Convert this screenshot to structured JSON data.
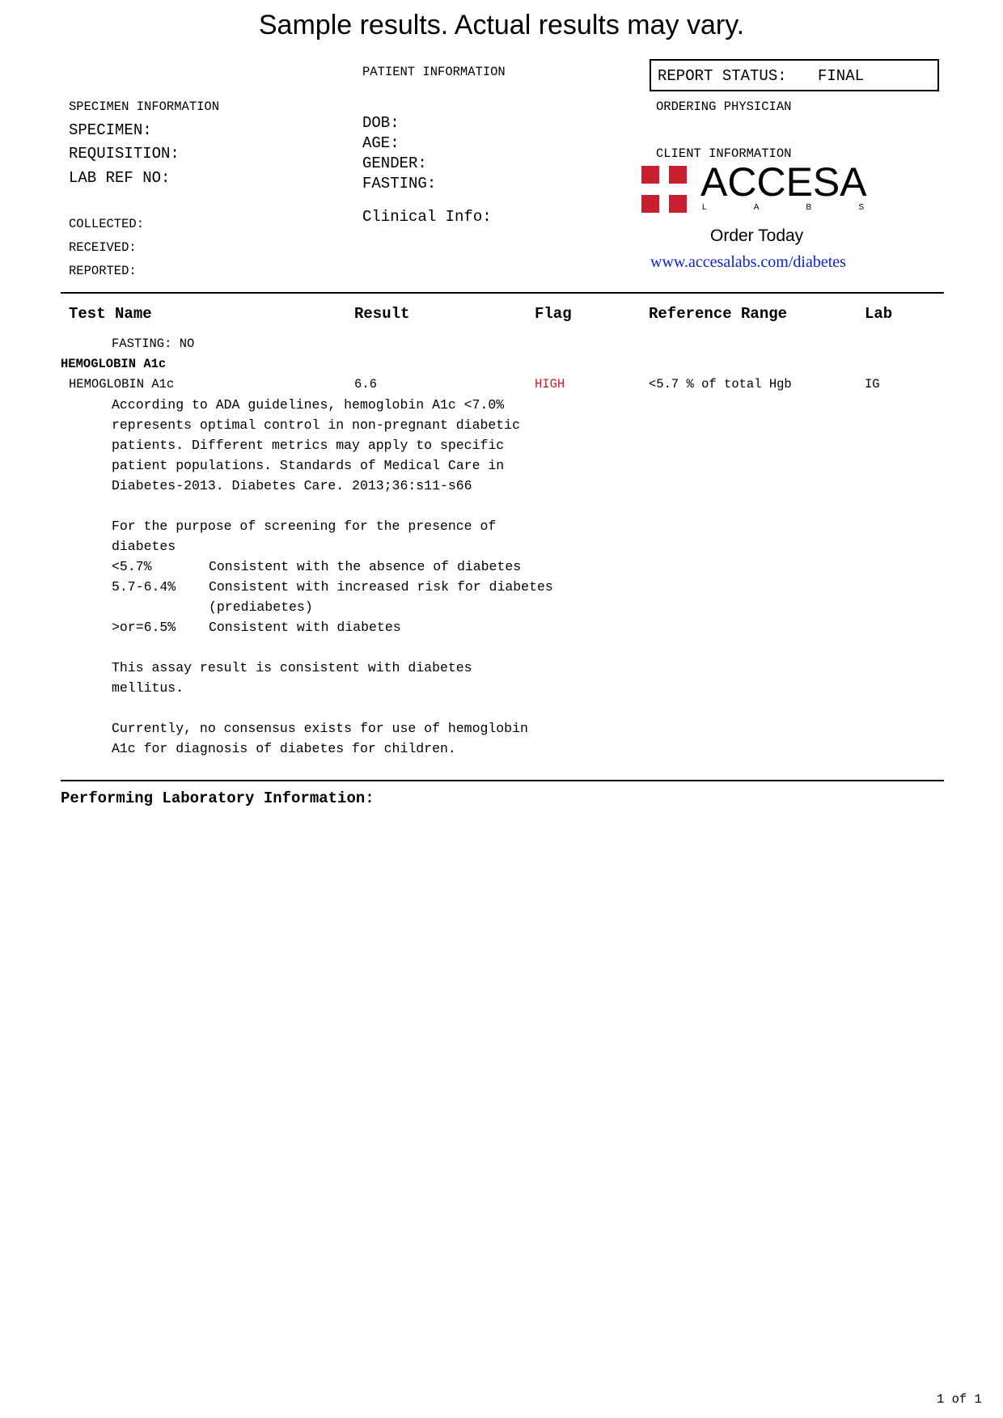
{
  "banner": "Sample results. Actual results may vary.",
  "patient_info": {
    "heading": "PATIENT INFORMATION",
    "dob": "DOB:",
    "age": "AGE:",
    "gender": "GENDER:",
    "fasting": "FASTING:",
    "clinical": "Clinical Info:"
  },
  "report_status": {
    "label": "REPORT STATUS:",
    "value": "FINAL"
  },
  "ordering_physician": "ORDERING PHYSICIAN",
  "client_info": "CLIENT INFORMATION",
  "specimen_info": {
    "heading": "SPECIMEN INFORMATION",
    "specimen": "SPECIMEN:",
    "requisition": "REQUISITION:",
    "lab_ref": "LAB REF NO:",
    "collected": "COLLECTED:",
    "received": "RECEIVED:",
    "reported": "REPORTED:"
  },
  "logo": {
    "word": "ACCESA",
    "sub": [
      "L",
      "A",
      "B",
      "S"
    ],
    "color": "#c8202f"
  },
  "order_today": "Order Today",
  "link": "www.accesalabs.com/diabetes",
  "table": {
    "headers": {
      "test_name": "Test Name",
      "result": "Result",
      "flag": "Flag",
      "reference_range": "Reference Range",
      "lab": "Lab"
    },
    "fasting_note": "FASTING: NO",
    "panel": "HEMOGLOBIN A1c",
    "row": {
      "test": "HEMOGLOBIN A1c",
      "result": "6.6",
      "flag": "HIGH",
      "reference": "<5.7 % of total Hgb",
      "lab": "IG"
    },
    "notes": [
      "According to ADA guidelines, hemoglobin A1c <7.0%",
      "represents optimal control in non-pregnant diabetic",
      "patients. Different metrics may apply to specific",
      "patient populations. Standards of Medical Care in",
      "Diabetes-2013. Diabetes Care. 2013;36:s11-s66",
      "",
      "For the purpose of screening for the presence of",
      "diabetes"
    ],
    "ranges": [
      {
        "range": "<5.7%",
        "text": "Consistent with the absence of diabetes"
      },
      {
        "range": "5.7-6.4%",
        "text": "Consistent with increased risk for diabetes"
      },
      {
        "range": "",
        "text": "(prediabetes)"
      },
      {
        "range": ">or=6.5%",
        "text": "Consistent with diabetes"
      }
    ],
    "notes2": [
      "This assay result is consistent with diabetes",
      "mellitus.",
      "",
      "Currently, no consensus exists for use of hemoglobin",
      "A1c for diagnosis of diabetes for children."
    ]
  },
  "performing_lab": "Performing Laboratory Information:",
  "page_number": "1 of 1",
  "colors": {
    "flag_high": "#cc1f1f",
    "link": "#0b22d6"
  }
}
